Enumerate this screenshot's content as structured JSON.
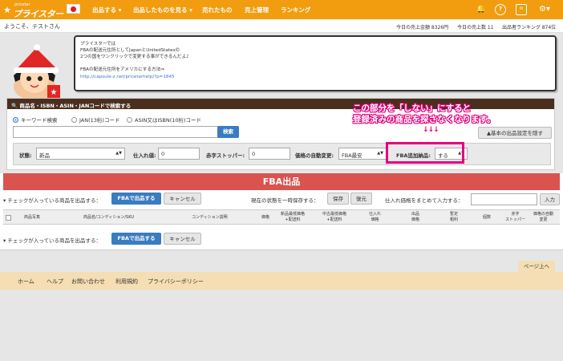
{
  "nav": {
    "logo_small": "pricetar",
    "logo_main": "プライスター",
    "items": [
      "出品する ▾",
      "出品したものを見る ▾",
      "売れたもの",
      "売上管理",
      "ランキング"
    ]
  },
  "welcome": {
    "greeting": "ようこそ、テストさん",
    "today_sales": "今日の売上金額 8326円",
    "today_count": "今日の売上数 11",
    "ranking": "出品者ランキング 874位"
  },
  "bubble": {
    "lines": [
      "プライスターでは",
      "FBAの配送元住所としてJapanとUnitedStatesの",
      "2つの国をワンクリックで変更する事ができるんだよ♪"
    ],
    "line2": "FBAの配送元住所をアメリカにする方法⇒",
    "link": "http://capsule-z.net/pricetarhelp/?p=1845"
  },
  "search": {
    "header": "🔍 商品名・ISBN・ASIN・JANコードで検索する",
    "radios": [
      "キーワード検索",
      "JAN(13桁)コード",
      "ASIN又はISBN(10桁)コード"
    ],
    "search_button": "検索",
    "hide_settings": "▲基本の出品設定を隠す",
    "condition_label": "状態:",
    "condition_value": "新品",
    "cost_label": "仕入れ値:",
    "cost_value": "0",
    "stopper_label": "赤字ストッパー:",
    "stopper_value": "0",
    "auto_price_label": "価格の自動変更:",
    "auto_price_value": "FBA最安",
    "fba_add_label": "FBA追加納品:",
    "fba_add_value": "する"
  },
  "callout": {
    "line1": "この部分を「しない」にすると",
    "line2": "登録済みの商品を探さなくなります。",
    "arrows": "↓↓↓"
  },
  "fba": {
    "title": "FBA出品",
    "bulk_label": "▾ チェックが入っている商品を出品する：",
    "fba_button": "FBAで出品する",
    "cancel_button": "キャンセル",
    "temp_save_label": "現在の状態を一時保存する：",
    "save_button": "保存",
    "restore_button": "復元",
    "bulk_price_label": "仕入れ価格をまとめて入力する：",
    "input_button": "入力",
    "columns": [
      "商品写真",
      "商品名/コンディション/SKU",
      "コンディション説明",
      "価格",
      "新品最低価格\n+配送料",
      "中古最低価格\n+配送料",
      "仕入れ\n価格",
      "出品\n価格",
      "暫定\n粗利",
      "個数",
      "赤字\nストッパー",
      "価格の自動\n変更"
    ]
  },
  "footer": {
    "page_top": "ページ上へ",
    "links": [
      "ホーム",
      "ヘルプ",
      "お問い合わせ",
      "利用規約",
      "プライバシーポリシー"
    ]
  }
}
